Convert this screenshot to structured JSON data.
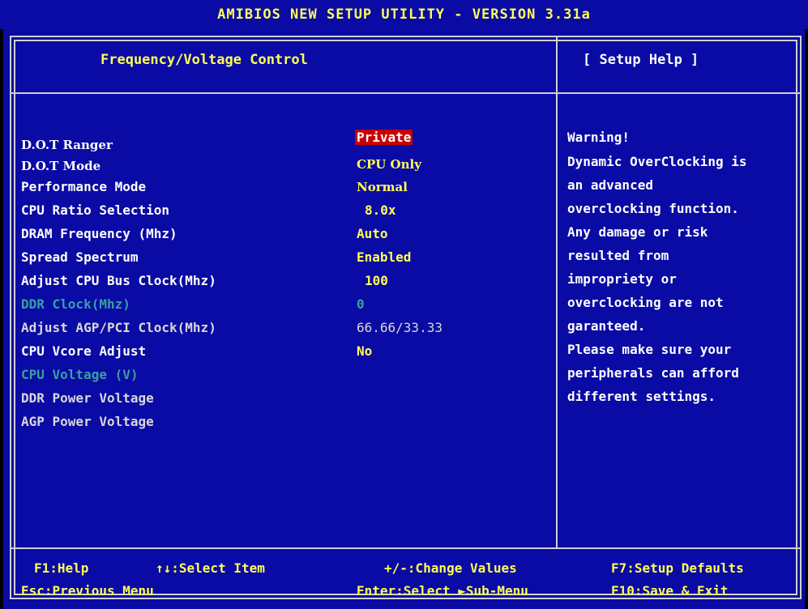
{
  "window": {
    "title": "AMIBIOS NEW SETUP UTILITY - VERSION 3.31a"
  },
  "panel": {
    "title": "Frequency/Voltage Control",
    "help_title": "[ Setup Help ]"
  },
  "settings": [
    {
      "label": "D.O.T Ranger",
      "value": "Private"
    },
    {
      "label": "D.O.T Mode",
      "value": "CPU Only"
    },
    {
      "label": "Performance Mode",
      "value": "Normal"
    },
    {
      "label": "CPU Ratio Selection",
      "value": "8.0x"
    },
    {
      "label": "DRAM Frequency (Mhz)",
      "value": "Auto"
    },
    {
      "label": "Spread Spectrum",
      "value": "Enabled"
    },
    {
      "label": "Adjust CPU Bus Clock(Mhz)",
      "value": "100"
    },
    {
      "label": "DDR Clock(Mhz)",
      "value": "0"
    },
    {
      "label": "Adjust AGP/PCI Clock(Mhz)",
      "value": "66.66/33.33"
    },
    {
      "label": "CPU Vcore Adjust",
      "value": "No"
    },
    {
      "label": "CPU Voltage (V)",
      "value": ""
    },
    {
      "label": "DDR Power Voltage",
      "value": ""
    },
    {
      "label": "AGP Power Voltage",
      "value": ""
    }
  ],
  "help": [
    "Warning!",
    "Dynamic OverClocking is",
    "an advanced",
    "overclocking function.",
    "Any damage or risk",
    "resulted from",
    "impropriety or",
    "overclocking are not",
    "garanteed.",
    "Please make sure your",
    "peripherals can afford",
    "different settings."
  ],
  "footer": {
    "f1": "F1:Help",
    "select_item": "↑↓:Select Item",
    "change_values": "+/-:Change Values",
    "f7": "F7:Setup Defaults",
    "esc": "Esc:Previous Menu",
    "enter": "Enter:Select ►Sub-Menu",
    "f10": "F10:Save & Exit"
  },
  "colors": {
    "background": "#0a0aa4",
    "title_text": "#ffff55",
    "selected_bg": "#c80000",
    "disabled_text": "#3aa0a0"
  }
}
